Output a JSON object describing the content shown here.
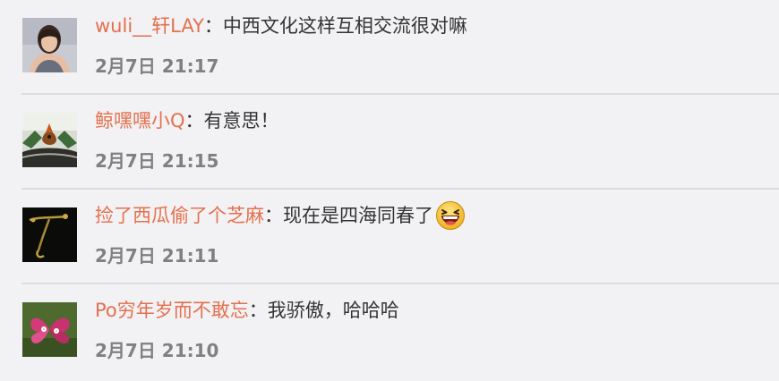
{
  "comments": [
    {
      "avatar": "avatar-woman-photo",
      "username": "wuli__轩LAY",
      "separator": "：",
      "text": "中西文化这样互相交流很对嘛",
      "timestamp": "2月7日 21:17"
    },
    {
      "avatar": "avatar-bird-photo",
      "username": "鲸嘿嘿小Q",
      "separator": "：",
      "text": "有意思！",
      "timestamp": "2月7日 21:15"
    },
    {
      "avatar": "avatar-plant-photo",
      "username": "捡了西瓜偷了个芝麻",
      "separator": "：",
      "text": "现在是四海同春了",
      "emoji": "laughing-face-emoji",
      "timestamp": "2月7日 21:11"
    },
    {
      "avatar": "avatar-flower-photo",
      "username": "Po穷年岁而不敢忘",
      "separator": "：",
      "text": "我骄傲，哈哈哈",
      "timestamp": "2月7日 21:10"
    }
  ],
  "colors": {
    "username": "#e4704d",
    "text": "#333333",
    "timestamp": "#808080",
    "background": "#f2f2f5",
    "divider": "#dcdcdf"
  }
}
